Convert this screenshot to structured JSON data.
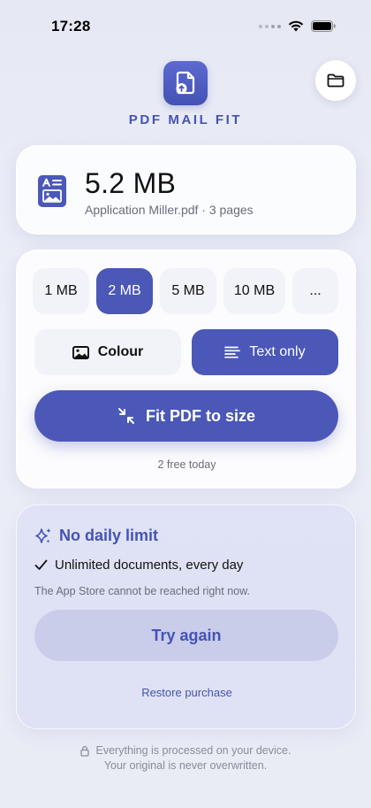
{
  "status_bar": {
    "time": "17:28"
  },
  "header": {
    "title": "PDF MAIL FIT"
  },
  "file": {
    "size": "5.2 MB",
    "meta": "Application Miller.pdf · 3 pages"
  },
  "target_sizes": [
    {
      "label": "1 MB",
      "selected": false
    },
    {
      "label": "2 MB",
      "selected": true
    },
    {
      "label": "5 MB",
      "selected": false
    },
    {
      "label": "10 MB",
      "selected": false
    },
    {
      "label": "...",
      "selected": false
    }
  ],
  "modes": [
    {
      "label": "Colour",
      "icon": "image-icon",
      "selected": false
    },
    {
      "label": "Text only",
      "icon": "text-lines-icon",
      "selected": true
    }
  ],
  "action": {
    "fit_label": "Fit PDF to size",
    "free_count": "2 free today"
  },
  "pro": {
    "title": "No daily limit",
    "feature": "Unlimited documents, every day",
    "note": "The App Store cannot be reached right now.",
    "retry_label": "Try again",
    "restore_label": "Restore purchase"
  },
  "footer": {
    "line1": "Everything is processed on your device.",
    "line2": "Your original is never overwritten."
  },
  "colors": {
    "accent": "#4b58b8",
    "accent_text": "#4453b5",
    "pro_bg": "#dde1f4",
    "retry_bg": "#c9cdea"
  }
}
